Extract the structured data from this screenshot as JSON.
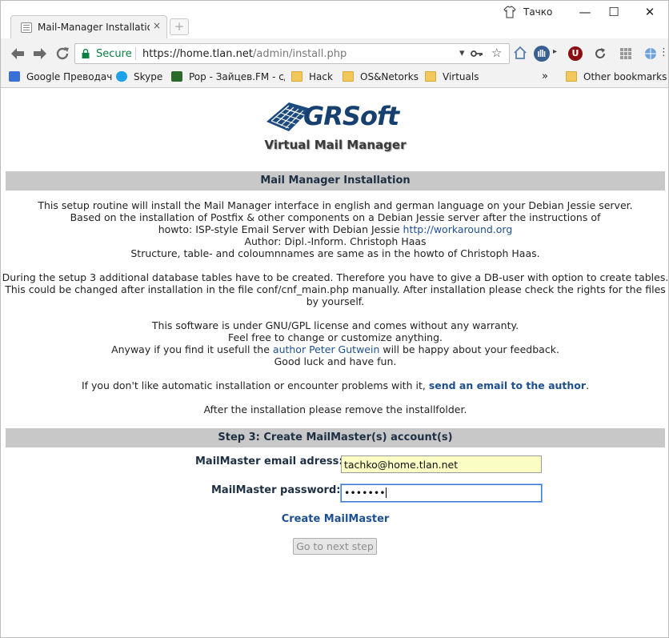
{
  "browser": {
    "tab_title": "Mail-Manager Installation",
    "tab_close": "×",
    "new_tab": "+",
    "profile_name": "Тачко",
    "window_controls": {
      "minimize": "—",
      "maximize": "☐",
      "close": "✕"
    },
    "secure_label": "Secure",
    "url_host": "https://home.tlan.net",
    "url_path": "/admin/install.php",
    "bookmarks": [
      {
        "label": "Google Преводач",
        "icon": "google-translate-icon",
        "color": "#3b6fd8"
      },
      {
        "label": "Skype",
        "icon": "skype-icon",
        "color": "#1ea1e6"
      },
      {
        "label": "Pop - Зайцев.FM - с/",
        "icon": "equalizer-icon",
        "color": "#2a6b2a"
      },
      {
        "label": "Hack",
        "icon": "folder-icon",
        "color": "#f2c75c"
      },
      {
        "label": "OS&Netorks",
        "icon": "folder-icon",
        "color": "#f2c75c"
      },
      {
        "label": "Virtuals",
        "icon": "folder-icon",
        "color": "#f2c75c"
      }
    ],
    "overflow": "»",
    "other_bookmarks": "Other bookmarks"
  },
  "page": {
    "logo_text": "GRSoft",
    "subtitle": "Virtual Mail Manager",
    "section1_title": "Mail Manager Installation",
    "intro": {
      "line1": "This setup routine will install the Mail Manager interface in english and german language on your Debian Jessie server.",
      "line2": "Based on the installation of Postfix & other components on a Debian Jessie server after the instructions of",
      "line3_text": "howto: ISP-style Email Server with Debian Jessie ",
      "line3_link": "http://workaround.org",
      "line4": "Author: Dipl.-Inform. Christoph Haas",
      "line5": "Structure, table- and coloumnnames are same as in the howto of Christoph Haas."
    },
    "setup": {
      "line1": "During the setup 3 additional database tables have to be created. Therefore you have to give a DB-user with option to create tables.",
      "line2": "This could be changed after installation in the file conf/cnf_main.php manually. After installation please check the rights for the files",
      "line3": "by yourself."
    },
    "license": {
      "line1": "This software is under GNU/GPL license and comes without any warranty.",
      "line2": "Feel free to change or customize anything.",
      "line3_pre": "Anyway if you find it usefull the ",
      "line3_link": "author Peter Gutwein",
      "line3_post": " will be happy about your feedback.",
      "line4": "Good luck and have fun."
    },
    "problems": {
      "pre": "If you don't like automatic installation or encounter problems with it, ",
      "link": "send an email to the author",
      "post": "."
    },
    "remove_note": "After the installation please remove the installfolder.",
    "section2_title": "Step 3: Create MailMaster(s) account(s)",
    "email_label": "MailMaster email adress:",
    "email_value": "tachko@home.tlan.net",
    "password_label": "MailMaster password:",
    "password_value": "•••••••",
    "create_label": "Create MailMaster",
    "next_button": "Go to next step"
  }
}
